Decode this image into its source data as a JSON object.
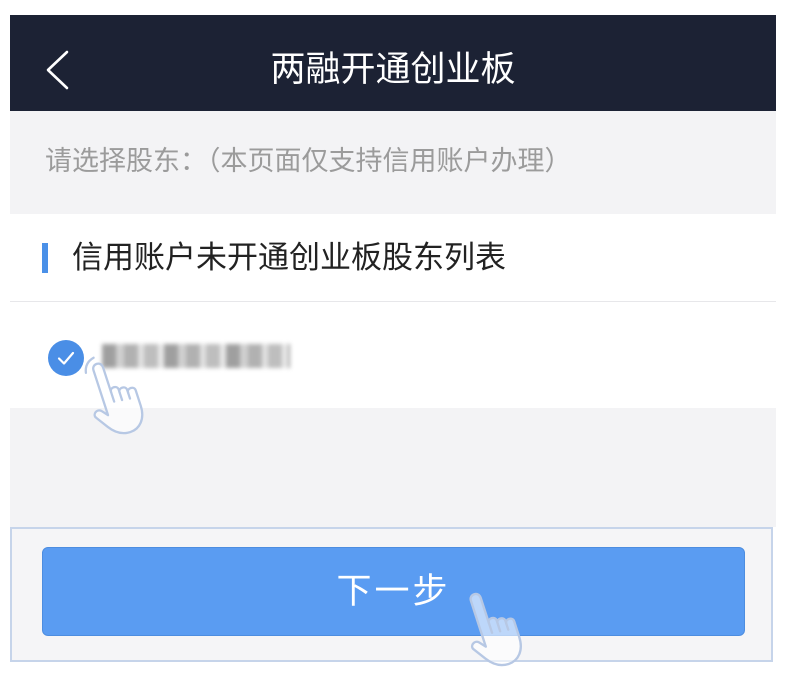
{
  "header": {
    "title": "两融开通创业板",
    "back_icon": "chevron-left-icon"
  },
  "notice": {
    "text": "请选择股东：（本页面仅支持信用账户办理）"
  },
  "shareholder_list": {
    "title": "信用账户未开通创业板股东列表",
    "items": [
      {
        "selected": true,
        "check_icon": "check-circle-icon"
      }
    ]
  },
  "footer": {
    "next_label": "下一步"
  },
  "overlays": {
    "hand_icon": "tap-hand-icon"
  },
  "colors": {
    "header_bg": "#1c2234",
    "accent": "#5a9cf2",
    "check": "#4a8ee6",
    "section_bar": "#4a90e8",
    "notice_text": "#9b9b9b",
    "page_bg": "#f3f3f5"
  }
}
